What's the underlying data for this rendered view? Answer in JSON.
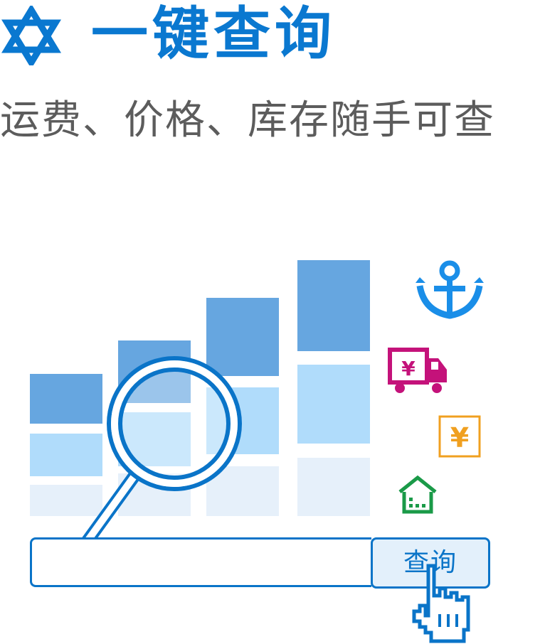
{
  "header": {
    "title": "一键查询",
    "subtitle": "运费、价格、库存随手可查",
    "icon": "star-of-david-icon",
    "title_color": "#0a78d0",
    "subtitle_color": "#5c5c5c"
  },
  "illustration": {
    "bar_colors": [
      "#e6f0fa",
      "#b0dcfb",
      "#66a6e0"
    ],
    "bars": [
      {
        "segments": [
          1,
          1,
          1
        ]
      },
      {
        "segments": [
          1,
          1,
          1
        ]
      },
      {
        "segments": [
          1,
          1,
          1
        ]
      },
      {
        "segments": [
          1,
          1,
          1
        ]
      }
    ],
    "side_icons": [
      "anchor-icon",
      "delivery-truck-yuan-icon",
      "yuan-icon",
      "warehouse-icon"
    ],
    "side_icon_colors": [
      "#1a8ee8",
      "#c4127a",
      "#f0a020",
      "#1a9a48"
    ],
    "magnifier_icon": "magnifying-glass-icon",
    "cursor_icon": "hand-pointer-icon"
  },
  "search": {
    "placeholder": "",
    "button_label": "查询",
    "accent_color": "#0a74c8"
  }
}
